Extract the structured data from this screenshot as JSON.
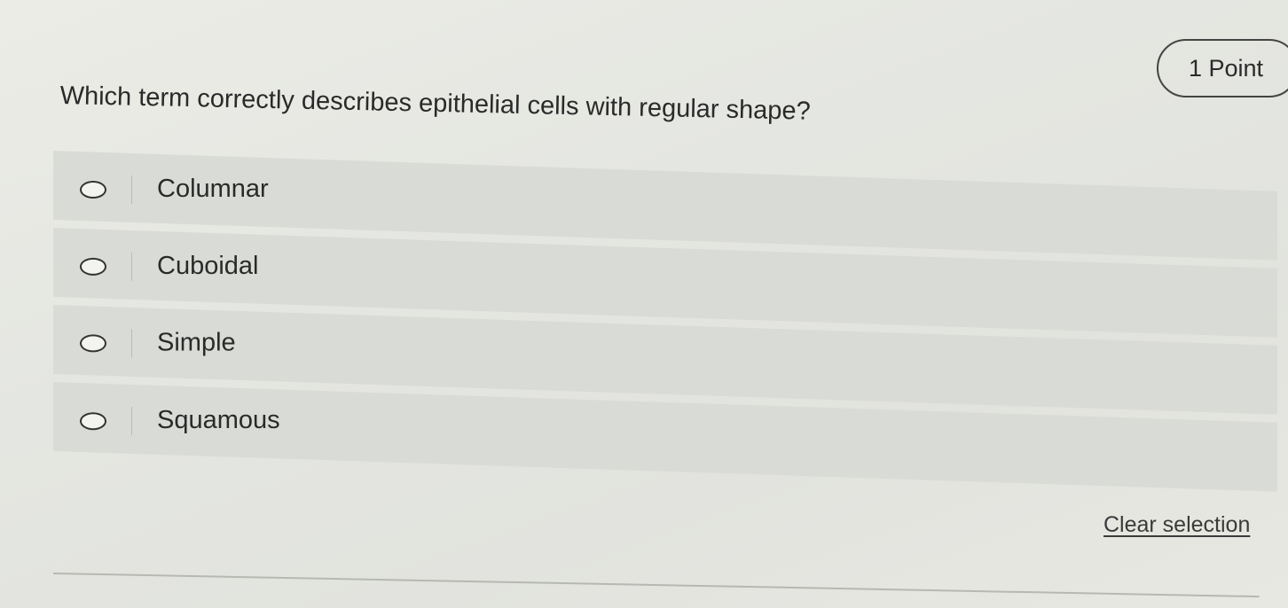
{
  "points": {
    "label": "1 Point"
  },
  "question": {
    "text": "Which term correctly describes epithelial cells with regular shape?"
  },
  "options": [
    {
      "label": "Columnar",
      "selected": false
    },
    {
      "label": "Cuboidal",
      "selected": false
    },
    {
      "label": "Simple",
      "selected": false
    },
    {
      "label": "Squamous",
      "selected": false
    }
  ],
  "clear_selection": {
    "label": "Clear selection"
  }
}
